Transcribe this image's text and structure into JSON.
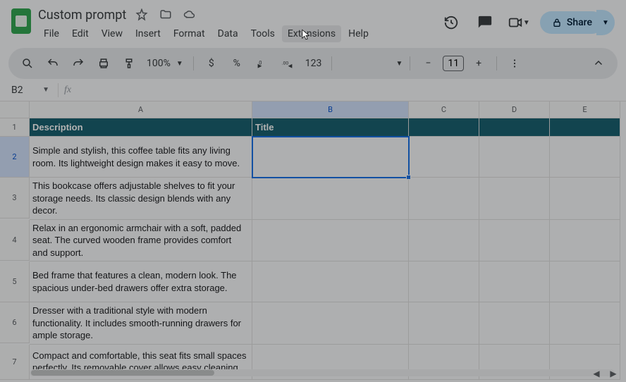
{
  "doc": {
    "title": "Custom prompt"
  },
  "menus": [
    "File",
    "Edit",
    "View",
    "Insert",
    "Format",
    "Data",
    "Tools",
    "Extensions",
    "Help"
  ],
  "toolbar": {
    "zoom": "100%",
    "fmt": {
      "currency": "$",
      "percent": "%",
      "dec_dec": ".0",
      "inc_dec": ".00",
      "fmt_more": "123"
    },
    "font_size": "11",
    "minus": "−",
    "plus": "+"
  },
  "share": {
    "label": "Share"
  },
  "namebox": {
    "cell": "B2",
    "fx": "fx"
  },
  "columns": [
    "A",
    "B",
    "C",
    "D",
    "E"
  ],
  "selected_col": "B",
  "selected_row": "2",
  "sheet": {
    "headers": {
      "A": "Description",
      "B": "Title"
    },
    "rows": [
      {
        "n": "1"
      },
      {
        "n": "2",
        "A": "Simple and stylish, this coffee table fits any living room. Its lightweight design makes it easy to move."
      },
      {
        "n": "3",
        "A": "This bookcase offers adjustable shelves to fit your storage needs. Its classic design blends with any decor."
      },
      {
        "n": "4",
        "A": "Relax in an ergonomic armchair with a soft, padded seat. The curved wooden frame provides comfort and support."
      },
      {
        "n": "5",
        "A": "Bed frame that features a clean, modern look. The spacious under-bed drawers offer extra storage."
      },
      {
        "n": "6",
        "A": "Dresser with a traditional style with modern functionality. It includes smooth-running drawers for ample storage."
      },
      {
        "n": "7",
        "A": "Compact and comfortable, this seat fits small spaces perfectly. Its removable cover allows easy cleaning."
      }
    ]
  }
}
